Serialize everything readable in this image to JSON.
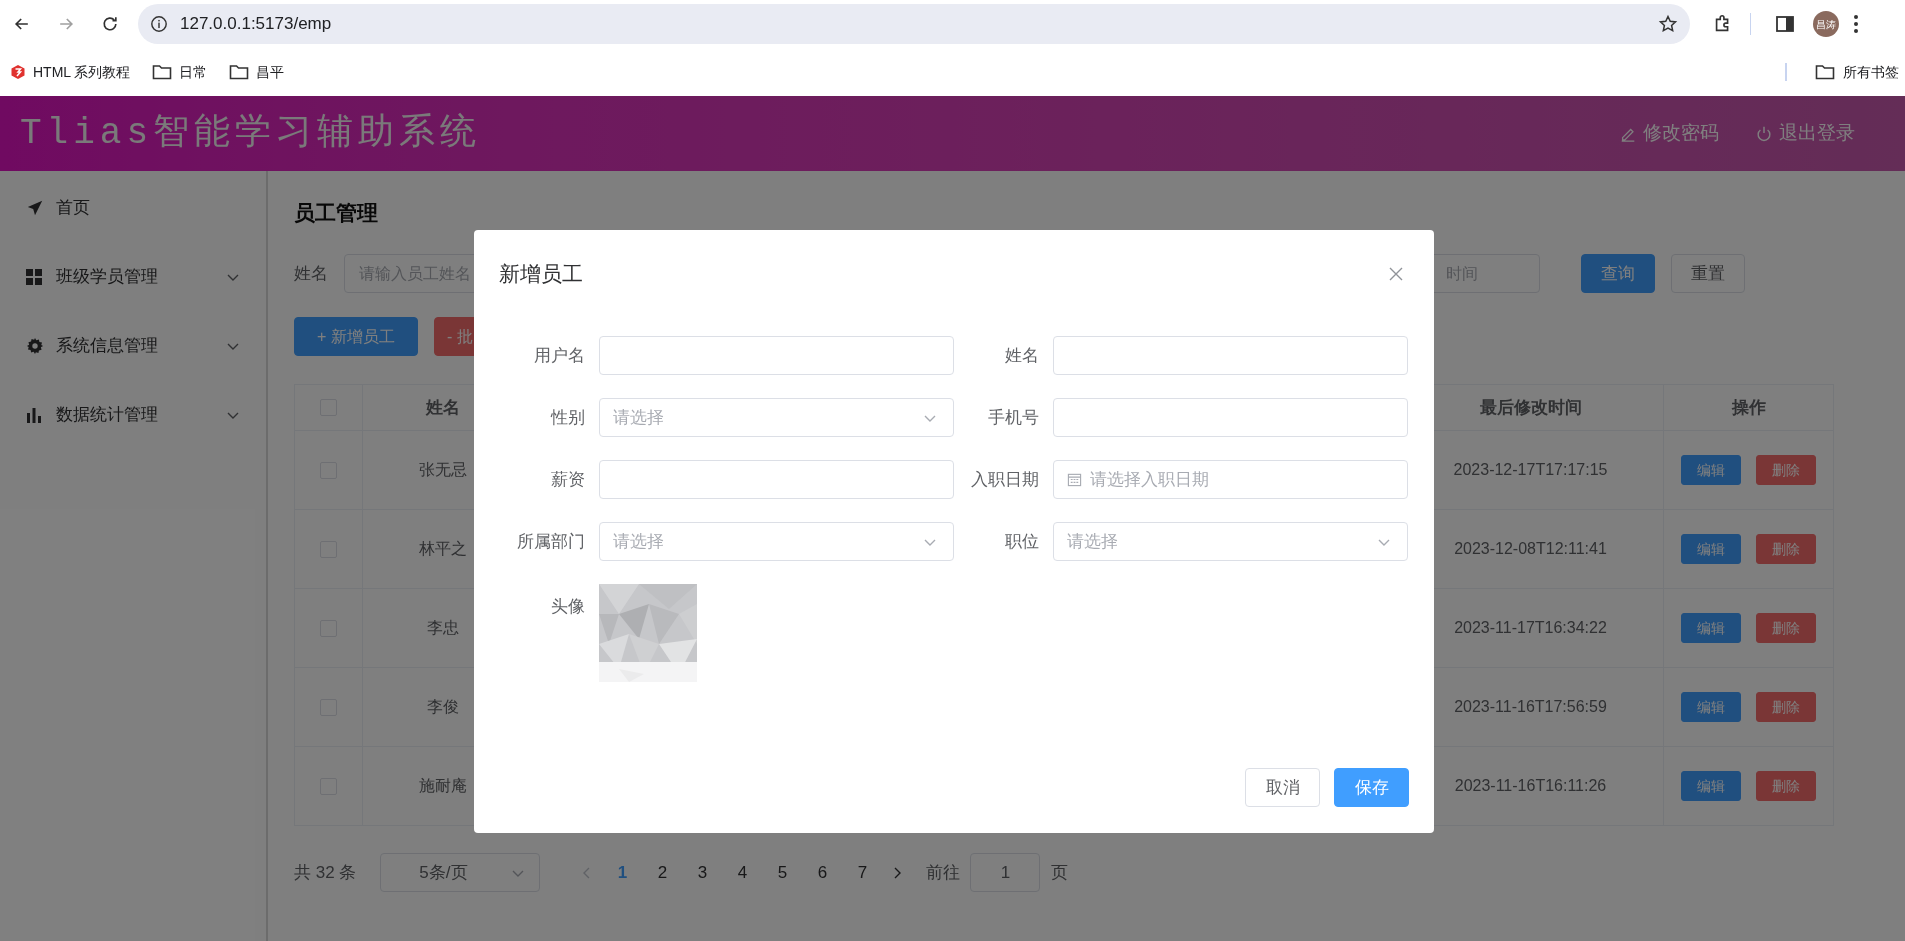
{
  "browser": {
    "nav": [
      {
        "kind": "back",
        "disabled": false
      },
      {
        "kind": "forward",
        "disabled": true
      },
      {
        "kind": "reload",
        "disabled": false
      }
    ],
    "url": "127.0.0.1:5173/emp",
    "profile": "昌涛",
    "bookmarks": [
      {
        "kind": "site",
        "label": "HTML 系列教程"
      },
      {
        "kind": "folder",
        "label": "日常"
      },
      {
        "kind": "folder",
        "label": "昌平"
      }
    ],
    "all_bookmarks": "所有书签"
  },
  "header": {
    "title": "Tlias智能学习辅助系统",
    "actions": [
      {
        "kind": "edit",
        "label": "修改密码"
      },
      {
        "kind": "logout",
        "label": "退出登录"
      }
    ]
  },
  "sidebar": {
    "items": [
      {
        "kind": "link",
        "label": "首页"
      },
      {
        "kind": "submenu",
        "label": "班级学员管理",
        "expanded": false
      },
      {
        "kind": "submenu",
        "label": "系统信息管理",
        "expanded": false
      },
      {
        "kind": "submenu",
        "label": "数据统计管理",
        "expanded": false
      }
    ]
  },
  "page": {
    "title": "员工管理",
    "search": {
      "name_label": "姓名",
      "name_placeholder": "请输入员工姓名",
      "date_placeholder": "时间",
      "buttons": [
        {
          "kind": "primary",
          "label": "查询"
        },
        {
          "kind": "default",
          "label": "重置"
        }
      ]
    },
    "toolbar": [
      {
        "kind": "primary",
        "label": "+ 新增员工"
      },
      {
        "kind": "danger",
        "label": "- 批"
      }
    ],
    "table": {
      "all_checked": false,
      "columns": [
        "姓名",
        "最后修改时间",
        "操作"
      ],
      "rows": [
        {
          "checked": false,
          "name": "张无忌",
          "last_modified": "2023-12-17T17:17:15",
          "actions": [
            {
              "kind": "primary",
              "label": "编辑"
            },
            {
              "kind": "danger",
              "label": "删除"
            }
          ]
        },
        {
          "checked": false,
          "name": "林平之",
          "last_modified": "2023-12-08T12:11:41",
          "actions": [
            {
              "kind": "primary",
              "label": "编辑"
            },
            {
              "kind": "danger",
              "label": "删除"
            }
          ]
        },
        {
          "checked": false,
          "name": "李忠",
          "last_modified": "2023-11-17T16:34:22",
          "actions": [
            {
              "kind": "primary",
              "label": "编辑"
            },
            {
              "kind": "danger",
              "label": "删除"
            }
          ]
        },
        {
          "checked": false,
          "name": "李俊",
          "last_modified": "2023-11-16T17:56:59",
          "actions": [
            {
              "kind": "primary",
              "label": "编辑"
            },
            {
              "kind": "danger",
              "label": "删除"
            }
          ]
        },
        {
          "checked": false,
          "name": "施耐庵",
          "last_modified": "2023-11-16T16:11:26",
          "actions": [
            {
              "kind": "primary",
              "label": "编辑"
            },
            {
              "kind": "danger",
              "label": "删除"
            }
          ]
        }
      ]
    },
    "pagination": {
      "total": "共 32 条",
      "page_size": "5条/页",
      "prev_disabled": true,
      "next_disabled": false,
      "pages": [
        {
          "label": "1",
          "selected": true
        },
        {
          "label": "2",
          "selected": false
        },
        {
          "label": "3",
          "selected": false
        },
        {
          "label": "4",
          "selected": false
        },
        {
          "label": "5",
          "selected": false
        },
        {
          "label": "6",
          "selected": false
        },
        {
          "label": "7",
          "selected": false
        }
      ],
      "goto_label": "前往",
      "goto_value": "1",
      "unit": "页"
    }
  },
  "dialog": {
    "title": "新增员工",
    "fields": [
      {
        "kind": "input",
        "label": "用户名"
      },
      {
        "kind": "input",
        "label": "姓名"
      },
      {
        "kind": "select",
        "label": "性别",
        "placeholder": "请选择"
      },
      {
        "kind": "input",
        "label": "手机号"
      },
      {
        "kind": "input",
        "label": "薪资"
      },
      {
        "kind": "date",
        "label": "入职日期",
        "placeholder": "请选择入职日期"
      },
      {
        "kind": "select",
        "label": "所属部门",
        "placeholder": "请选择"
      },
      {
        "kind": "select",
        "label": "职位",
        "placeholder": "请选择"
      }
    ],
    "avatar": {
      "label": "头像",
      "kind": "picture"
    },
    "buttons": [
      {
        "kind": "default",
        "label": "取消"
      },
      {
        "kind": "primary",
        "label": "保存"
      }
    ]
  }
}
